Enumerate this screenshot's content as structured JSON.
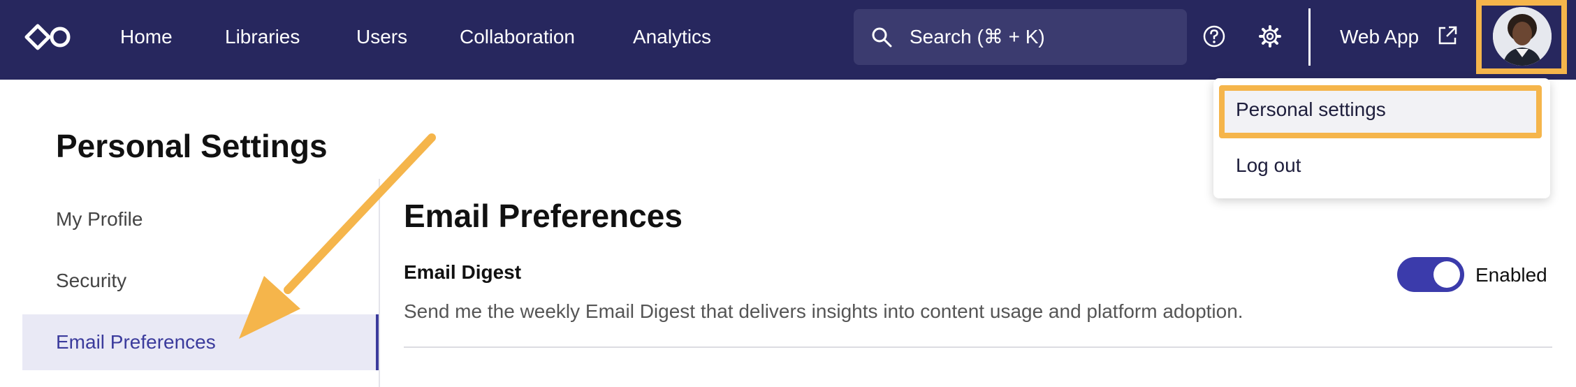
{
  "nav": {
    "items": [
      "Home",
      "Libraries",
      "Users",
      "Collaboration",
      "Analytics"
    ],
    "search_placeholder": "Search (⌘ + K)",
    "webapp_label": "Web App"
  },
  "dropdown": {
    "items": [
      "Personal settings",
      "Log out"
    ]
  },
  "page": {
    "title": "Personal Settings",
    "sidebar": [
      "My Profile",
      "Security",
      "Email Preferences"
    ]
  },
  "content": {
    "section_title": "Email Preferences",
    "digest_title": "Email Digest",
    "digest_desc": "Send me the weekly Email Digest that delivers insights into content usage and platform adoption.",
    "toggle_label": "Enabled",
    "toggle_on": true
  },
  "colors": {
    "nav_bg": "#27275e",
    "accent": "#3b3bab",
    "highlight": "#f5b54b"
  },
  "icons": [
    "logo-icon",
    "search-icon",
    "help-icon",
    "gear-icon",
    "external-link-icon"
  ]
}
